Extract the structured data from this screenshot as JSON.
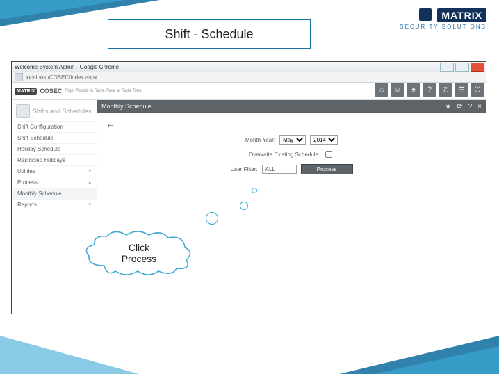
{
  "brand": {
    "name": "MATRIX",
    "tagline": "SECURITY SOLUTIONS"
  },
  "slide_title": "Shift - Schedule",
  "window": {
    "title": "Welcome System Admin - Google Chrome",
    "url": "localhost/COSEC/index.aspx"
  },
  "app": {
    "logo_small": "MATRIX",
    "product": "COSEC",
    "tagline": "Right People in Right Place at Right Time"
  },
  "iconbar": [
    "home",
    "user",
    "bell",
    "help",
    "phone",
    "grid",
    "power"
  ],
  "sidebar": {
    "group_title": "Shifts and Schedules",
    "items": [
      {
        "label": "Shift Configuration"
      },
      {
        "label": "Shift Schedule"
      },
      {
        "label": "Holiday Schedule"
      },
      {
        "label": "Restricted Holidays"
      },
      {
        "label": "Utilities",
        "caret": true
      },
      {
        "label": "Process",
        "caret": true
      },
      {
        "label": "Monthly Schedule",
        "active": true
      },
      {
        "label": "Reports",
        "caret": true
      }
    ]
  },
  "panel": {
    "title": "Monthly Schedule",
    "star": "★",
    "refresh": "⟳",
    "help": "?",
    "close": "×",
    "month_label": "Month-Year:",
    "month": "May",
    "year": "2014",
    "overwrite_label": "Overwrite Existing Schedule",
    "overwrite": false,
    "userfilter_label": "User Filter:",
    "userfilter": "ALL",
    "process_btn": "Process"
  },
  "callout_line1": "Click",
  "callout_line2": "Process"
}
